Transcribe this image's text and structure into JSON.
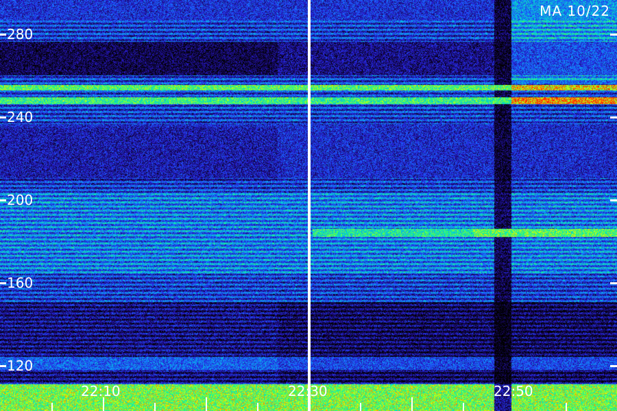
{
  "station": "MA 10/22",
  "y_axis": {
    "labels": [
      "280",
      "240",
      "200",
      "160",
      "120"
    ]
  },
  "x_axis": {
    "labels": [
      "22:10",
      "22:30",
      "22:50"
    ]
  },
  "colors": {
    "background": "#000000",
    "text": "#ffffff",
    "palette": [
      "#000000",
      "#1a0a6e",
      "#2a2ae6",
      "#1e90ff",
      "#00e0d0",
      "#3cff50",
      "#e8ff00",
      "#ff2a00"
    ]
  },
  "scale": "colormap intensity (dark blue low, red high)"
}
